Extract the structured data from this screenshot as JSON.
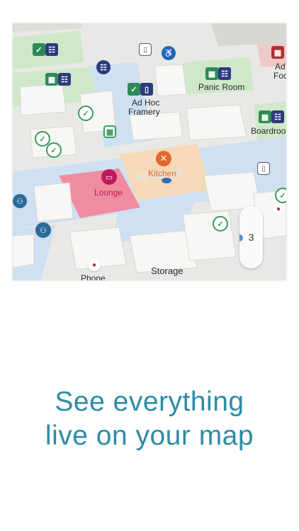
{
  "map": {
    "rooms": {
      "panic_room": "Panic Room",
      "ad_hoc": "Ad Hoc",
      "framery": "Framery",
      "boardroom": "Boardroo",
      "kitchen": "Kitchen",
      "lounge": "Lounge",
      "storage": "Storage",
      "phone": "Phone",
      "adhoc_partial_1": "Ad",
      "adhoc_partial_2": "Foc"
    },
    "level": "3",
    "colors": {
      "corridor": "#cfe0f3",
      "kitchen": "#f6d9b8",
      "lounge": "#f08ca0",
      "lounge_text": "#c2185b",
      "kitchen_icon": "#e06a2b",
      "green_room": "#cfe8c9"
    },
    "icons": [
      "check-icon",
      "meeting-room-icon",
      "wheelchair-icon",
      "restroom-icon",
      "kitchen-icon",
      "lounge-tv-icon",
      "person-icon",
      "calendar-icon",
      "door-icon"
    ]
  },
  "tagline": {
    "line1": "See everything",
    "line2": "live on your map"
  }
}
